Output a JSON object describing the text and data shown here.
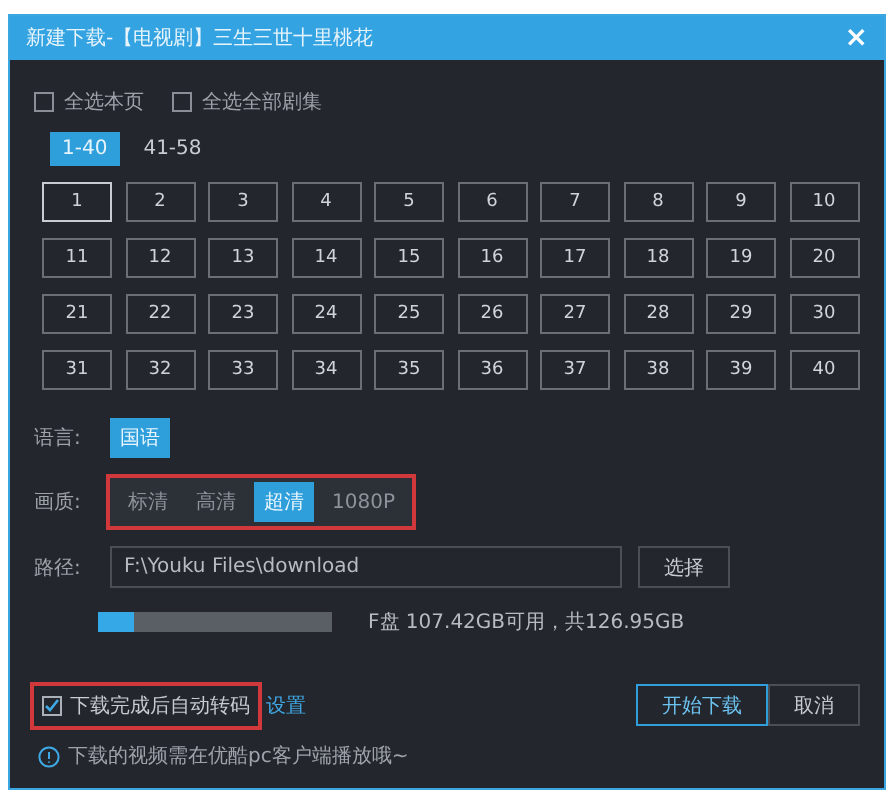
{
  "window": {
    "title": "新建下载-【电视剧】三生三世十里桃花",
    "close": "×"
  },
  "select_options": [
    {
      "label": "全选本页",
      "checked": false
    },
    {
      "label": "全选全部剧集",
      "checked": false
    }
  ],
  "page_tabs": [
    {
      "label": "1-40",
      "selected": true
    },
    {
      "label": "41-58",
      "selected": false
    }
  ],
  "episodes": [
    {
      "label": "1",
      "selected": true
    },
    {
      "label": "2",
      "selected": false
    },
    {
      "label": "3",
      "selected": false
    },
    {
      "label": "4",
      "selected": false
    },
    {
      "label": "5",
      "selected": false
    },
    {
      "label": "6",
      "selected": false
    },
    {
      "label": "7",
      "selected": false
    },
    {
      "label": "8",
      "selected": false
    },
    {
      "label": "9",
      "selected": false
    },
    {
      "label": "10",
      "selected": false
    },
    {
      "label": "11",
      "selected": false
    },
    {
      "label": "12",
      "selected": false
    },
    {
      "label": "13",
      "selected": false
    },
    {
      "label": "14",
      "selected": false
    },
    {
      "label": "15",
      "selected": false
    },
    {
      "label": "16",
      "selected": false
    },
    {
      "label": "17",
      "selected": false
    },
    {
      "label": "18",
      "selected": false
    },
    {
      "label": "19",
      "selected": false
    },
    {
      "label": "20",
      "selected": false
    },
    {
      "label": "21",
      "selected": false
    },
    {
      "label": "22",
      "selected": false
    },
    {
      "label": "23",
      "selected": false
    },
    {
      "label": "24",
      "selected": false
    },
    {
      "label": "25",
      "selected": false
    },
    {
      "label": "26",
      "selected": false
    },
    {
      "label": "27",
      "selected": false
    },
    {
      "label": "28",
      "selected": false
    },
    {
      "label": "29",
      "selected": false
    },
    {
      "label": "30",
      "selected": false
    },
    {
      "label": "31",
      "selected": false
    },
    {
      "label": "32",
      "selected": false
    },
    {
      "label": "33",
      "selected": false
    },
    {
      "label": "34",
      "selected": false
    },
    {
      "label": "35",
      "selected": false
    },
    {
      "label": "36",
      "selected": false
    },
    {
      "label": "37",
      "selected": false
    },
    {
      "label": "38",
      "selected": false
    },
    {
      "label": "39",
      "selected": false
    },
    {
      "label": "40",
      "selected": false
    }
  ],
  "language": {
    "label": "语言:",
    "options": [
      {
        "label": "国语",
        "selected": true
      }
    ]
  },
  "quality": {
    "label": "画质:",
    "highlighted": true,
    "options": [
      {
        "label": "标清",
        "selected": false
      },
      {
        "label": "高清",
        "selected": false
      },
      {
        "label": "超清",
        "selected": true
      },
      {
        "label": "1080P",
        "selected": false
      }
    ]
  },
  "path": {
    "label": "路径:",
    "value": "F:\\Youku Files\\download",
    "button": "选择"
  },
  "disk": {
    "level": 0.15,
    "text": "F盘 107.42GB可用，共126.95GB"
  },
  "auto_transcode": {
    "label": "下载完成后自动转码",
    "checked": true,
    "highlighted": true,
    "link": "设置"
  },
  "buttons": [
    {
      "label": "开始下载",
      "primary": true
    },
    {
      "label": "取消",
      "primary": false
    }
  ],
  "notice": "下载的视频需在优酷pc客户端播放哦~"
}
